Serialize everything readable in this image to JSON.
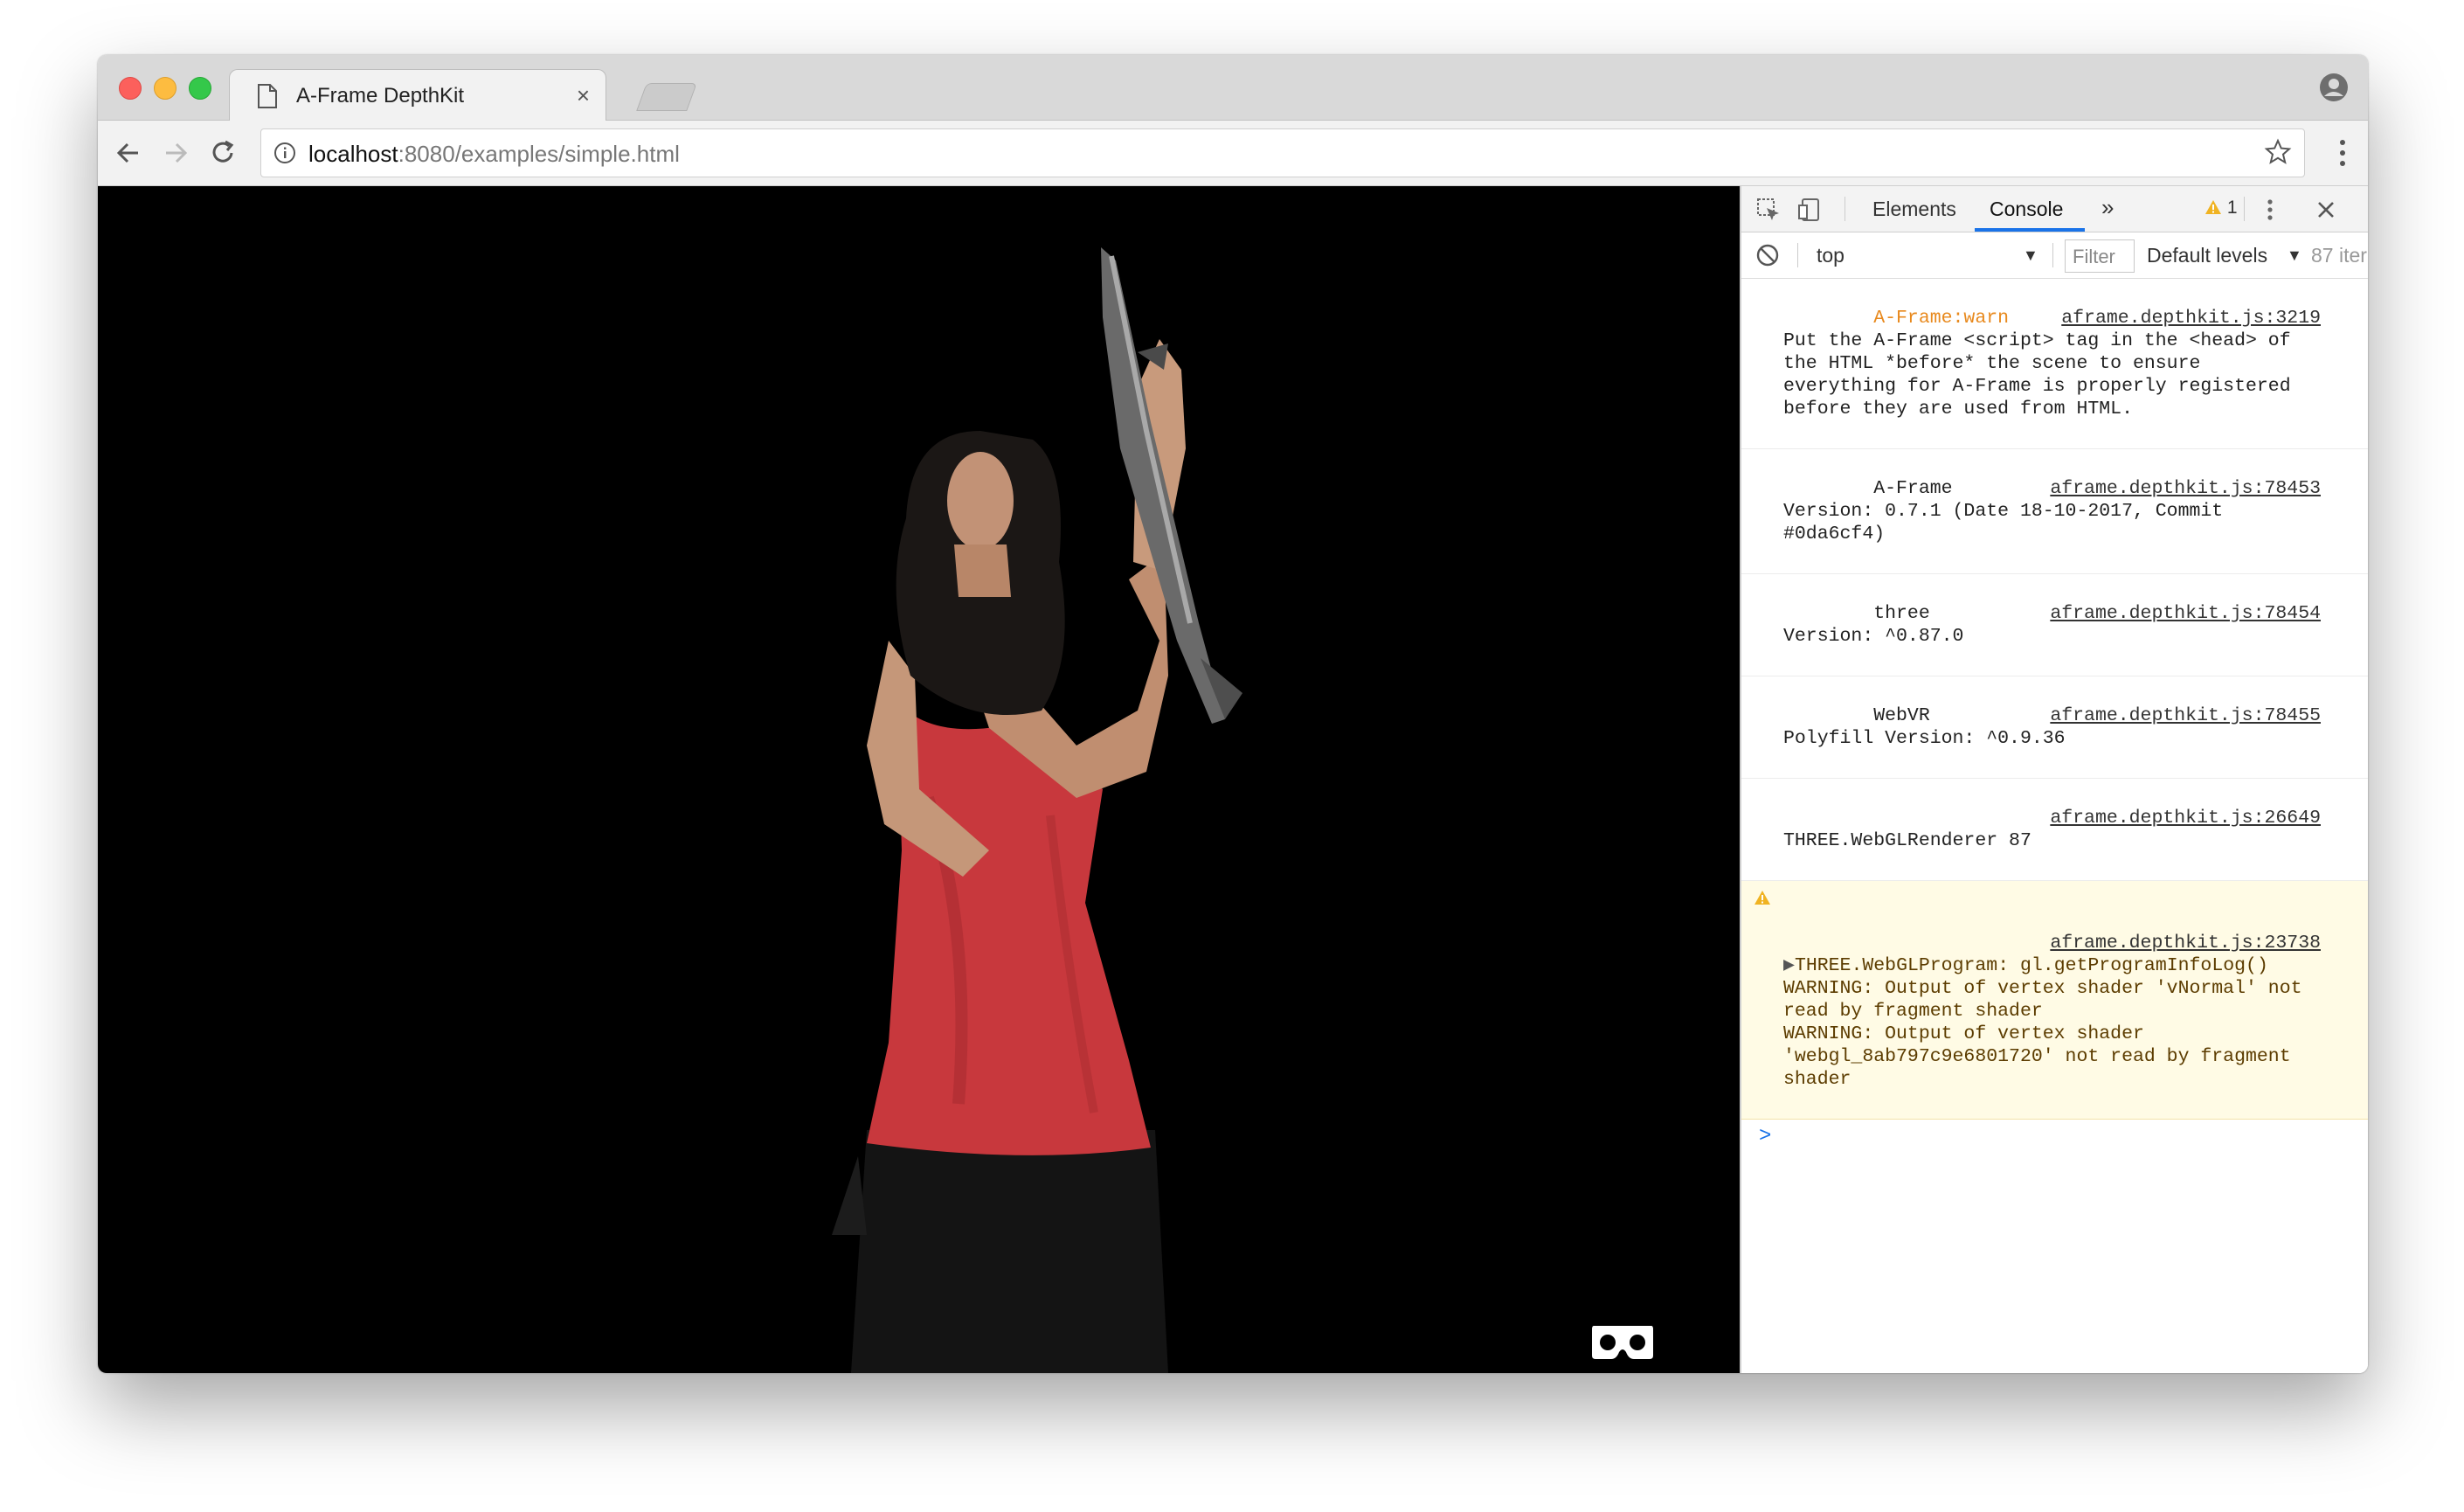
{
  "browser": {
    "tab_title": "A-Frame DepthKit",
    "tab_close": "×",
    "url_host": "localhost",
    "url_path": ":8080/examples/simple.html"
  },
  "devtools": {
    "tabs": [
      "Elements",
      "Console",
      "»"
    ],
    "warning_count": "1",
    "context": "top",
    "filter_placeholder": "Filter",
    "levels": "Default levels",
    "items_hidden": "87 iter",
    "messages": [
      {
        "level_label": "A-Frame:warn",
        "source": "aframe.depthkit.js:3219",
        "text": " Put the A-Frame <script> tag in the <head> of the HTML *before* the scene to ensure everything for A-Frame is properly registered before they are used from HTML."
      },
      {
        "source": "aframe.depthkit.js:78453",
        "text": "A-Frame Version: 0.7.1 (Date 18-10-2017, Commit #0da6cf4)"
      },
      {
        "source": "aframe.depthkit.js:78454",
        "text": "three Version: ^0.87.0"
      },
      {
        "source": "aframe.depthkit.js:78455",
        "text": "WebVR Polyfill Version: ^0.9.36"
      },
      {
        "source": "aframe.depthkit.js:26649",
        "text": "THREE.WebGLRenderer 87"
      },
      {
        "source": "aframe.depthkit.js:23738",
        "arrow": "▶",
        "text": "THREE.WebGLProgram: gl.getProgramInfoLog() WARNING: Output of vertex shader 'vNormal' not read by fragment shader\nWARNING: Output of vertex shader 'webgl_8ab797c9e6801720' not read by fragment shader"
      }
    ],
    "prompt": ">"
  },
  "colors": {
    "accent": "#1a73e8",
    "warn": "#e8891d",
    "dress": "#c8383d"
  }
}
